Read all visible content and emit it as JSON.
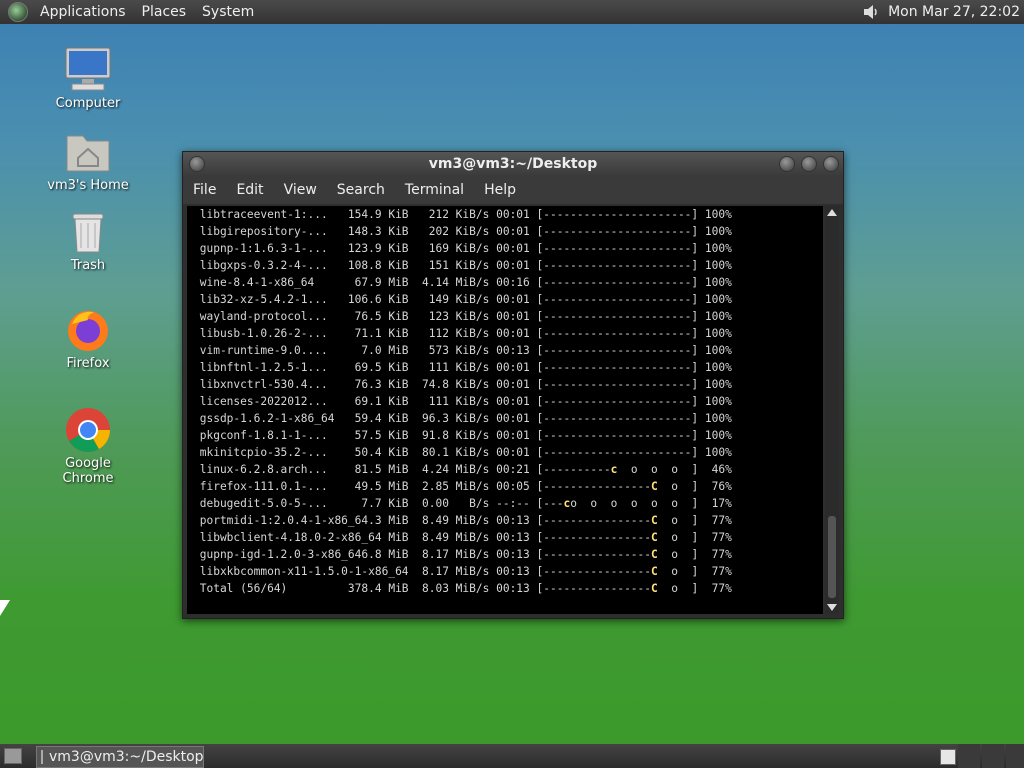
{
  "top_panel": {
    "menus": [
      "Applications",
      "Places",
      "System"
    ],
    "clock": "Mon Mar 27, 22:02"
  },
  "desktop_icons": [
    {
      "label": "Computer",
      "icon": "computer-icon"
    },
    {
      "label": "vm3's Home",
      "icon": "home-folder-icon"
    },
    {
      "label": "Trash",
      "icon": "trash-icon"
    },
    {
      "label": "Firefox",
      "icon": "firefox-icon"
    },
    {
      "label": "Google Chrome",
      "icon": "chrome-icon"
    }
  ],
  "terminal": {
    "title": "vm3@vm3:~/Desktop",
    "menu": [
      "File",
      "Edit",
      "View",
      "Search",
      "Terminal",
      "Help"
    ],
    "lines": [
      " libtraceevent-1:...   154.9 KiB   212 KiB/s 00:01 [----------------------] 100%",
      " libgirepository-...   148.3 KiB   202 KiB/s 00:01 [----------------------] 100%",
      " gupnp-1:1.6.3-1-...   123.9 KiB   169 KiB/s 00:01 [----------------------] 100%",
      " libgxps-0.3.2-4-...   108.8 KiB   151 KiB/s 00:01 [----------------------] 100%",
      " wine-8.4-1-x86_64      67.9 MiB  4.14 MiB/s 00:16 [----------------------] 100%",
      " lib32-xz-5.4.2-1...   106.6 KiB   149 KiB/s 00:01 [----------------------] 100%",
      " wayland-protocol...    76.5 KiB   123 KiB/s 00:01 [----------------------] 100%",
      " libusb-1.0.26-2-...    71.1 KiB   112 KiB/s 00:01 [----------------------] 100%",
      " vim-runtime-9.0....     7.0 MiB   573 KiB/s 00:13 [----------------------] 100%",
      " libnftnl-1.2.5-1...    69.5 KiB   111 KiB/s 00:01 [----------------------] 100%",
      " libxnvctrl-530.4...    76.3 KiB  74.8 KiB/s 00:01 [----------------------] 100%",
      " licenses-2022012...    69.1 KiB   111 KiB/s 00:01 [----------------------] 100%",
      " gssdp-1.6.2-1-x86_64   59.4 KiB  96.3 KiB/s 00:01 [----------------------] 100%",
      " pkgconf-1.8.1-1-...    57.5 KiB  91.8 KiB/s 00:01 [----------------------] 100%",
      " mkinitcpio-35.2-...    50.4 KiB  80.1 KiB/s 00:01 [----------------------] 100%",
      " linux-6.2.8.arch...    81.5 MiB  4.24 MiB/s 00:21 [----------c  o  o  o  ]  46%",
      " firefox-111.0.1-...    49.5 MiB  2.85 MiB/s 00:05 [----------------C  o  ]  76%",
      " debugedit-5.0-5-...     7.7 KiB  0.00   B/s --:-- [---co  o  o  o  o  o  ]  17%",
      " portmidi-1:2.0.4-1-x86_64.3 MiB  8.49 MiB/s 00:13 [----------------C  o  ]  77%",
      " libwbclient-4.18.0-2-x86_64 MiB  8.49 MiB/s 00:13 [----------------C  o  ]  77%",
      " gupnp-igd-1.2.0-3-x86_646.8 MiB  8.17 MiB/s 00:13 [----------------C  o  ]  77%",
      " libxkbcommon-x11-1.5.0-1-x86_64  8.17 MiB/s 00:13 [----------------C  o  ]  77%",
      " Total (56/64)         378.4 MiB  8.03 MiB/s 00:13 [----------------C  o  ]  77%"
    ]
  },
  "taskbar": {
    "task_label": "vm3@vm3:~/Desktop"
  }
}
